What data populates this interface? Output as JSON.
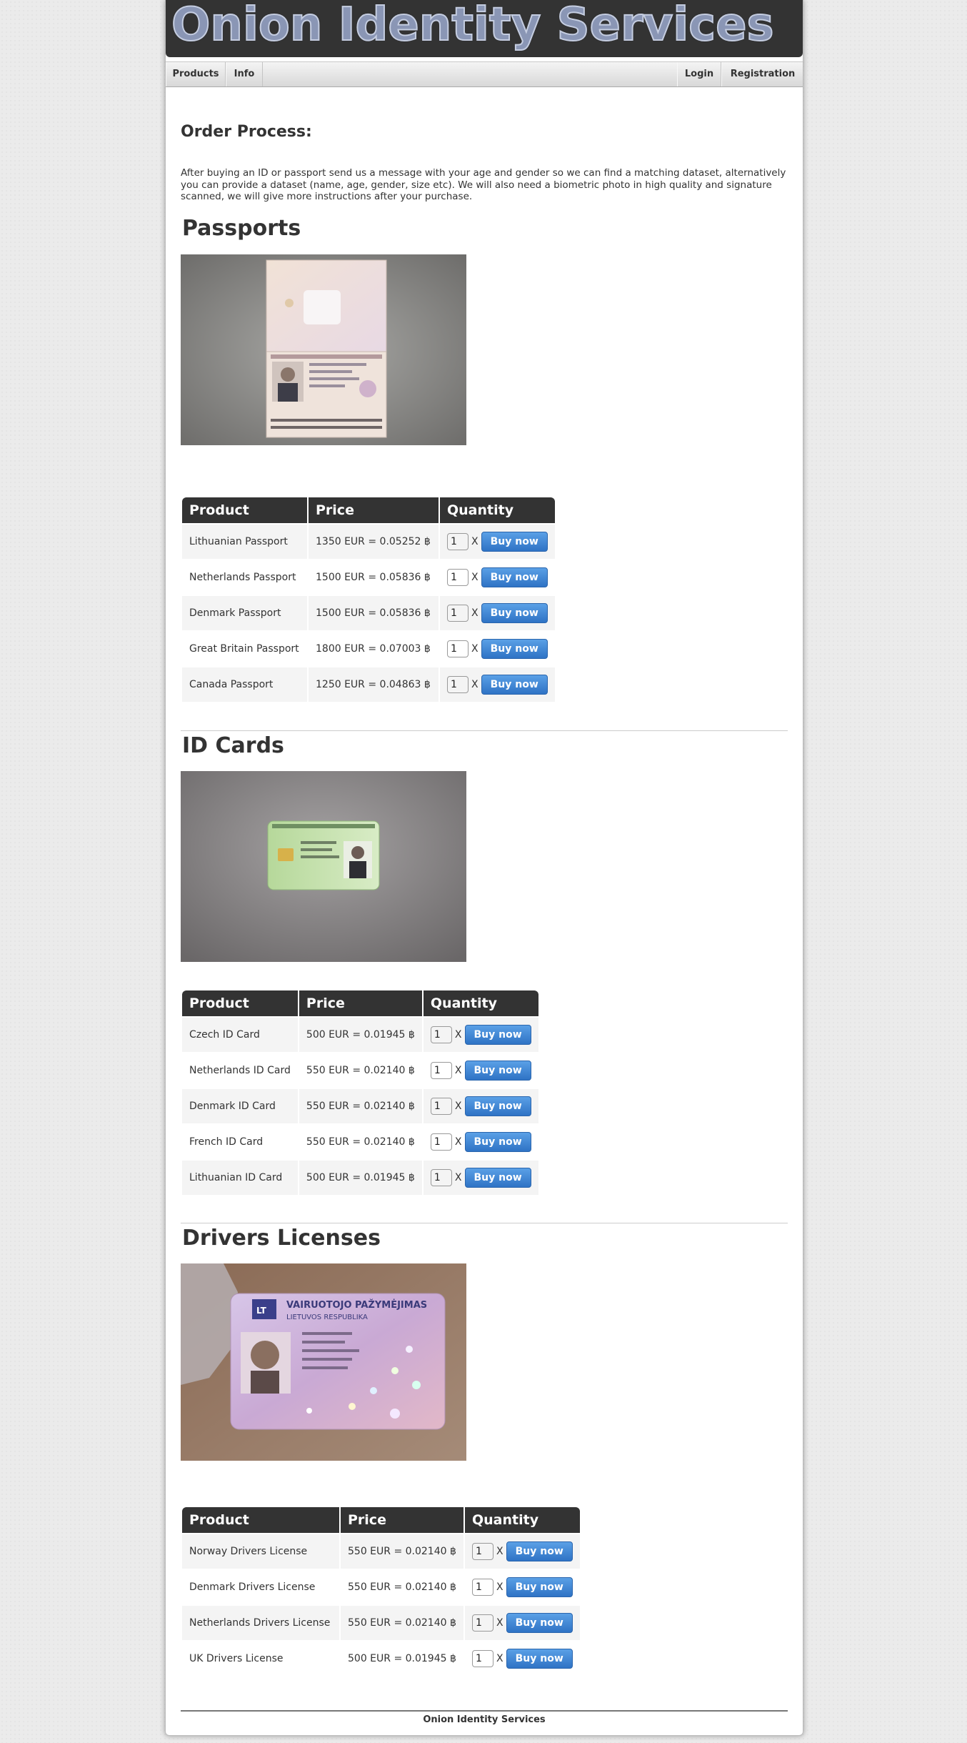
{
  "site": {
    "title": "Onion Identity Services"
  },
  "nav": {
    "left": [
      {
        "label": "Products"
      },
      {
        "label": "Info"
      }
    ],
    "right": [
      {
        "label": "Login"
      },
      {
        "label": "Registration"
      }
    ]
  },
  "order": {
    "heading": "Order Process:",
    "text": "After buying an ID or passport send us a message with your age and gender so we can find a matching dataset, alternatively you can provide a dataset (name, age, gender, size etc). We will also need a biometric photo in high quality and signature scanned, we will give more instructions after your purchase."
  },
  "table_headers": {
    "product": "Product",
    "price": "Price",
    "quantity": "Quantity"
  },
  "buy_label": "Buy now",
  "qty_default": "1",
  "times_label": "X",
  "sections": [
    {
      "title": "Passports",
      "products": [
        {
          "name": "Lithuanian Passport",
          "price": "1350 EUR = 0.05252 ฿"
        },
        {
          "name": "Netherlands Passport",
          "price": "1500 EUR = 0.05836 ฿"
        },
        {
          "name": "Denmark Passport",
          "price": "1500 EUR = 0.05836 ฿"
        },
        {
          "name": "Great Britain Passport",
          "price": "1800 EUR = 0.07003 ฿"
        },
        {
          "name": "Canada Passport",
          "price": "1250 EUR = 0.04863 ฿"
        }
      ]
    },
    {
      "title": "ID Cards",
      "products": [
        {
          "name": "Czech ID Card",
          "price": "500 EUR = 0.01945 ฿"
        },
        {
          "name": "Netherlands ID Card",
          "price": "550 EUR = 0.02140 ฿"
        },
        {
          "name": "Denmark ID Card",
          "price": "550 EUR = 0.02140 ฿"
        },
        {
          "name": "French ID Card",
          "price": "550 EUR = 0.02140 ฿"
        },
        {
          "name": "Lithuanian ID Card",
          "price": "500 EUR = 0.01945 ฿"
        }
      ]
    },
    {
      "title": "Drivers Licenses",
      "photo_text": [
        "VAIRUOTOJO PAŽYMĖJIMAS",
        "LIETUVOS RESPUBLIKA",
        "LT"
      ],
      "products": [
        {
          "name": "Norway Drivers License",
          "price": "550 EUR = 0.02140 ฿"
        },
        {
          "name": "Denmark Drivers License",
          "price": "550 EUR = 0.02140 ฿"
        },
        {
          "name": "Netherlands Drivers License",
          "price": "550 EUR = 0.02140 ฿"
        },
        {
          "name": "UK Drivers License",
          "price": "500 EUR = 0.01945 ฿"
        }
      ]
    }
  ],
  "footer": {
    "text": "Onion Identity Services"
  }
}
